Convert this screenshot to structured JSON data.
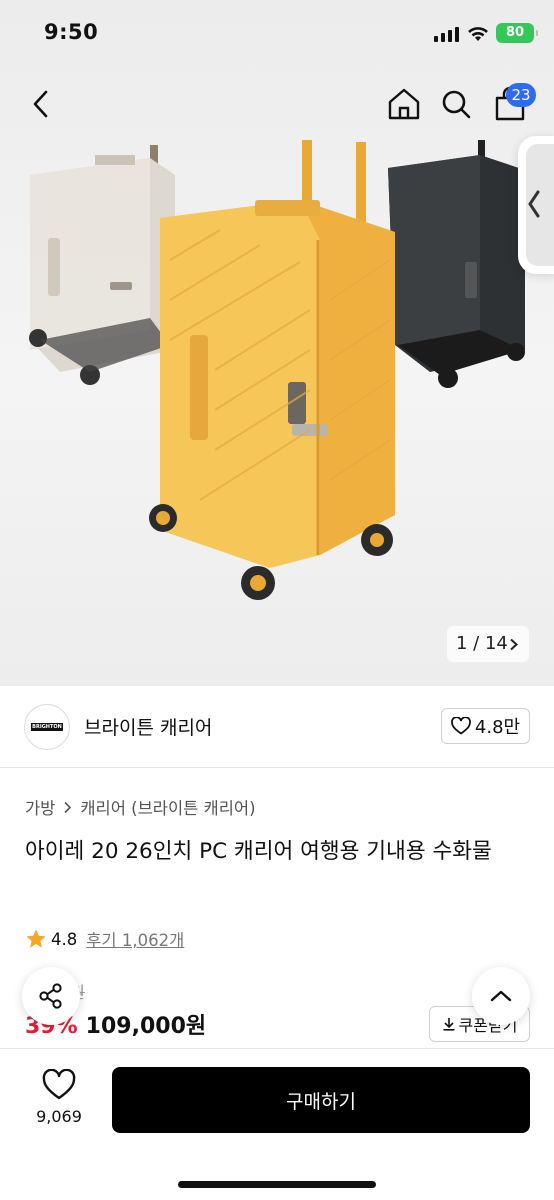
{
  "status_bar": {
    "time": "9:50",
    "battery": "80"
  },
  "header": {
    "cart_count": "23"
  },
  "gallery": {
    "counter": "1 / 14"
  },
  "seller": {
    "logo_text": "BRIGHTON",
    "name": "브라이튼 캐리어",
    "likes": "4.8만"
  },
  "breadcrumb": {
    "items": [
      "가방",
      "캐리어 (브라이튼 캐리어)"
    ]
  },
  "product": {
    "title": "아이레 20 26인치 PC 캐리어 여행용 기내용 수화물",
    "rating": "4.8",
    "reviews": "후기 1,062개",
    "original_price": "0원",
    "discount": "39%",
    "price": "109,000원",
    "coupon_label": "쿠폰받기"
  },
  "bottom_bar": {
    "wish_count": "9,069",
    "buy_label": "구매하기"
  },
  "colors": {
    "accent_red": "#e0203a",
    "badge_blue": "#2e6bf0",
    "star": "#f5a623",
    "buy_bg": "#000000"
  },
  "icons": [
    "back-icon",
    "home-icon",
    "search-icon",
    "cart-icon",
    "share-icon",
    "chevron-up-icon",
    "heart-icon",
    "star-icon",
    "download-icon",
    "chevron-right-icon",
    "chevron-left-icon"
  ]
}
